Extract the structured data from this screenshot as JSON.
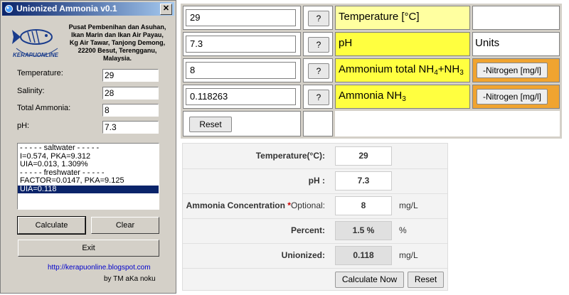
{
  "app": {
    "title": "Unionized Ammonia v0.1",
    "close_glyph": "✕",
    "logo_text": "KERAPUONLINE",
    "address_lines": [
      "Pusat Pembenihan dan Asuhan,",
      "Ikan Marin dan Ikan Air Payau,",
      "Kg Air Tawar, Tanjong Demong,",
      "22200 Besut, Terengganu,",
      "Malaysia."
    ],
    "fields": [
      {
        "label": "Temperature:",
        "value": "29"
      },
      {
        "label": "Salinity:",
        "value": "28"
      },
      {
        "label": "Total Ammonia:",
        "value": "8"
      },
      {
        "label": "pH:",
        "value": "7.3"
      }
    ],
    "results": [
      "- - - - - saltwater - - - - -",
      "I=0.574, PKA=9.312",
      "UIA=0.013, 1.309%",
      "- - - - - freshwater - - - - -",
      "FACTOR=0.0147, PKA=9.125",
      "UIA=0.118"
    ],
    "selected_result_index": 5,
    "buttons": {
      "calculate": "Calculate",
      "clear": "Clear",
      "exit": "Exit"
    },
    "link": "http://kerapuonline.blogspot.com",
    "byline": "by TM aKa noku"
  },
  "grid": {
    "rows": [
      {
        "value": "29",
        "help": "?",
        "label": "Temperature [°C]",
        "extra": ""
      },
      {
        "value": "7.3",
        "help": "?",
        "label": "pH",
        "extra": "Units"
      },
      {
        "value": "8",
        "help": "?",
        "label_main": "Ammonium total NH",
        "label_sub1": "4",
        "label_mid": "+NH",
        "label_sub2": "3",
        "button": "-Nitrogen [mg/l]"
      },
      {
        "value": "0.118263",
        "help": "?",
        "label_main": "Ammonia NH",
        "label_sub1": "3",
        "button": "-Nitrogen [mg/l]"
      }
    ],
    "reset_label": "Reset"
  },
  "form": {
    "rows": [
      {
        "label": "Temperature(°C):",
        "value": "29",
        "unit": ""
      },
      {
        "label": "pH :",
        "value": "7.3",
        "unit": ""
      },
      {
        "label": "Ammonia Concentration ",
        "star": "*",
        "optional": "Optional:",
        "value": "8",
        "unit": "mg/L"
      },
      {
        "label": "Percent:",
        "value": "1.5 %",
        "unit": "%"
      },
      {
        "label": "Unionized:",
        "value": "0.118",
        "unit": "mg/L"
      }
    ],
    "calculate_label": "Calculate Now",
    "reset_label": "Reset"
  },
  "colors": {
    "titlebar_start": "#0a246a",
    "titlebar_end": "#a6caf0",
    "yellow_label": "#ffff40",
    "light_yellow_label": "#ffffa0",
    "orange_cell": "#f0a430",
    "selection": "#0a246a",
    "link": "#0000cc"
  },
  "icons": [
    "app-icon",
    "close-icon",
    "fish-logo"
  ]
}
